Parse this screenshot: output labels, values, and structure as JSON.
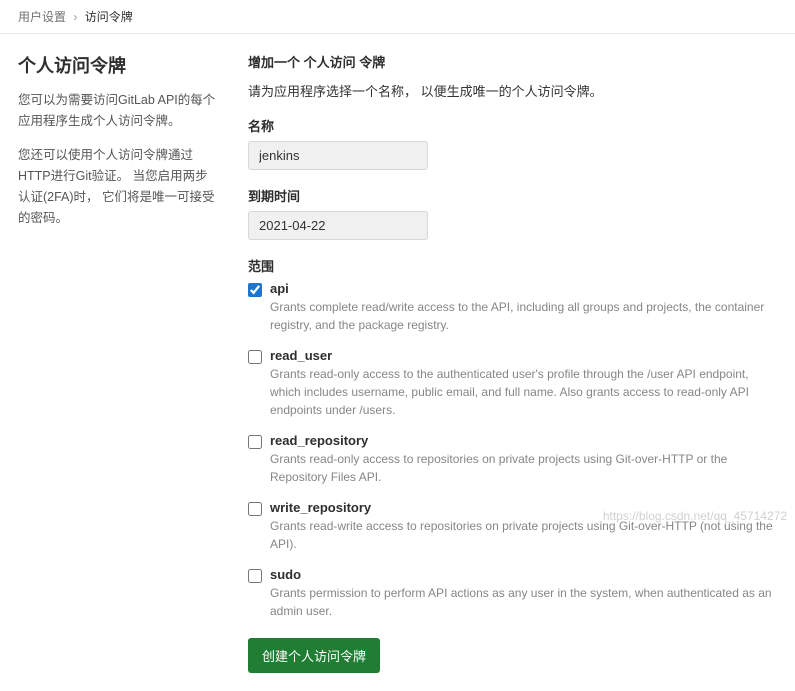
{
  "breadcrumb": {
    "parent": "用户设置",
    "current": "访问令牌"
  },
  "sidebar": {
    "title": "个人访问令牌",
    "para1": "您可以为需要访问GitLab API的每个应用程序生成个人访问令牌。",
    "para2": "您还可以使用个人访问令牌通过HTTP进行Git验证。 当您启用两步认证(2FA)时， 它们将是唯一可接受的密码。"
  },
  "main": {
    "form_title": "增加一个 个人访问 令牌",
    "instruction": "请为应用程序选择一个名称， 以便生成唯一的个人访问令牌。",
    "name_label": "名称",
    "name_value": "jenkins",
    "expiry_label": "到期时间",
    "expiry_value": "2021-04-22",
    "scope_label": "范围",
    "submit_label": "创建个人访问令牌"
  },
  "scopes": [
    {
      "name": "api",
      "desc": "Grants complete read/write access to the API, including all groups and projects, the container registry, and the package registry.",
      "checked": true
    },
    {
      "name": "read_user",
      "desc": "Grants read-only access to the authenticated user's profile through the /user API endpoint, which includes username, public email, and full name. Also grants access to read-only API endpoints under /users.",
      "checked": false
    },
    {
      "name": "read_repository",
      "desc": "Grants read-only access to repositories on private projects using Git-over-HTTP or the Repository Files API.",
      "checked": false
    },
    {
      "name": "write_repository",
      "desc": "Grants read-write access to repositories on private projects using Git-over-HTTP (not using the API).",
      "checked": false
    },
    {
      "name": "sudo",
      "desc": "Grants permission to perform API actions as any user in the system, when authenticated as an admin user.",
      "checked": false
    }
  ],
  "watermark": "https://blog.csdn.net/qq_45714272"
}
